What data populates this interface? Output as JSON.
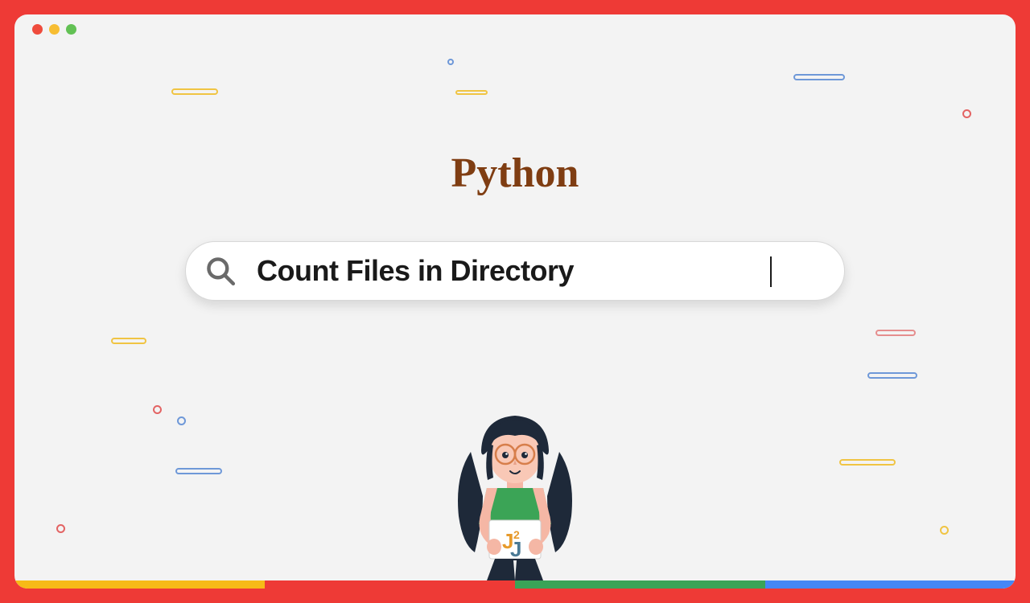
{
  "title": "Python",
  "search": {
    "query": "Count Files in Directory"
  },
  "logo": "J2J",
  "colors": {
    "accent_yellow": "#f7ba17",
    "accent_red": "#ee3a36",
    "accent_green": "#3aa457",
    "accent_blue": "#4487f6",
    "title_brown": "#7f3d12"
  }
}
